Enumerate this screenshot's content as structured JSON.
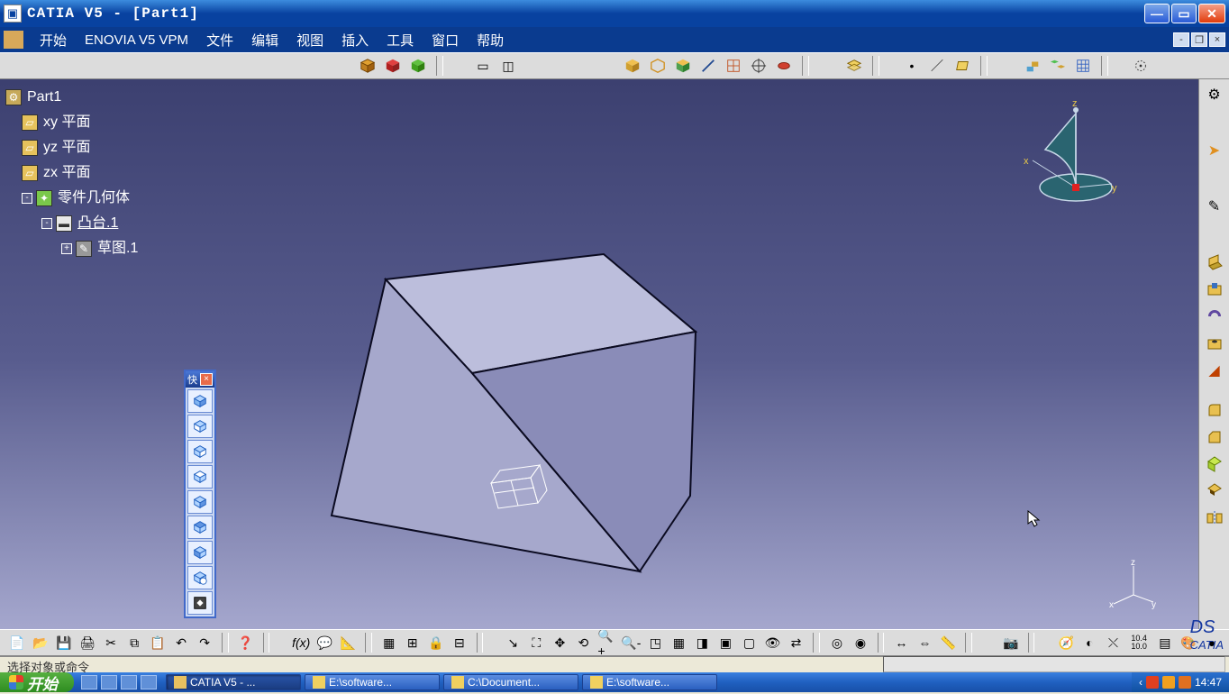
{
  "titlebar": {
    "title": "CATIA V5 - [Part1]"
  },
  "menubar": {
    "items": [
      "开始",
      "ENOVIA V5 VPM",
      "文件",
      "编辑",
      "视图",
      "插入",
      "工具",
      "窗口",
      "帮助"
    ]
  },
  "tree": {
    "root": "Part1",
    "planes": [
      "xy 平面",
      "yz 平面",
      "zx 平面"
    ],
    "body": "零件几何体",
    "pad": "凸台.1",
    "sketch": "草图.1"
  },
  "float_toolbar": {
    "title": "快"
  },
  "status": {
    "text": "选择对象或命令"
  },
  "compass_axes": {
    "x": "x",
    "y": "y",
    "z": "z"
  },
  "mini_axes": {
    "x": "x",
    "y": "y",
    "z": "z"
  },
  "taskbar": {
    "start": "开始",
    "items": [
      {
        "label": "CATIA V5 - ...",
        "active": true
      },
      {
        "label": "E:\\software...",
        "active": false
      },
      {
        "label": "C:\\Document...",
        "active": false
      },
      {
        "label": "E:\\software...",
        "active": false
      }
    ],
    "clock": "14:47"
  },
  "logo": {
    "ds": "DS",
    "name": "CATIA"
  },
  "top_numeric": {
    "a": "10.4",
    "b": "10.0"
  },
  "colors": {
    "xp_blue": "#0842a0",
    "canvas_top": "#3c4070",
    "canvas_bot": "#a8aad0",
    "box_face": "#9096c0"
  }
}
